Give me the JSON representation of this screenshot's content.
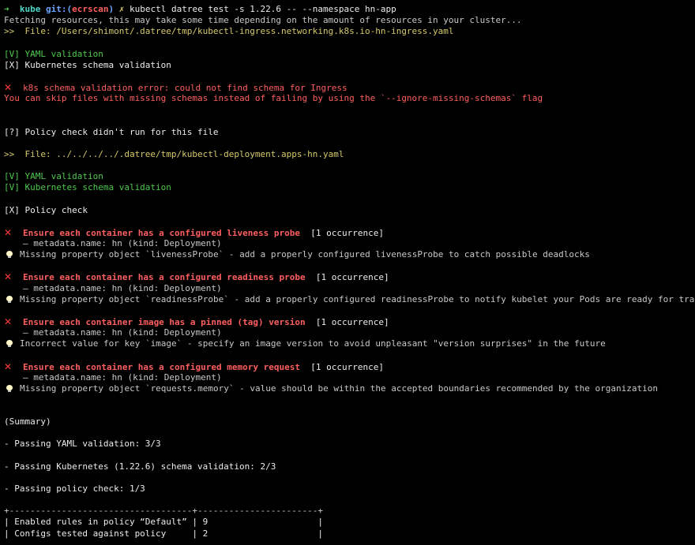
{
  "colors": {
    "background": "#000000",
    "error": "#ff5f5f",
    "success": "#4ec94e",
    "path": "#d6c96a"
  },
  "prompt": {
    "arrow": "➜",
    "dir": "kube",
    "git_label": "git:(",
    "branch": "ecrscan",
    "git_close": ")",
    "dirty_mark": "✗",
    "command": "kubectl datree test -s 1.22.6 -- --namespace hn-app"
  },
  "intro": "Fetching resources, this may take some time depending on the amount of resources in your cluster...",
  "file1": {
    "header": ">>  File: /Users/shimont/.datree/tmp/kubectl-ingress.networking.k8s.io-hn-ingress.yaml",
    "yaml_validation": "[V] YAML validation",
    "schema_validation": "[X] Kubernetes schema validation",
    "schema_error": "k8s schema validation error: could not find schema for Ingress",
    "skip_hint": "You can skip files with missing schemas instead of failing by using the `--ignore-missing-schemas` flag",
    "policy_check": "[?] Policy check didn't run for this file"
  },
  "file2": {
    "header": ">>  File: ../../../../.datree/tmp/kubectl-deployment.apps-hn.yaml",
    "yaml_validation": "[V] YAML validation",
    "schema_validation": "[V] Kubernetes schema validation",
    "policy_check": "[X] Policy check",
    "rules": [
      {
        "title": "Ensure each container has a configured liveness probe",
        "occurrence": "[1 occurrence]",
        "metadata": "— metadata.name: hn (kind: Deployment)",
        "hint": "Missing property object `livenessProbe` - add a properly configured livenessProbe to catch possible deadlocks"
      },
      {
        "title": "Ensure each container has a configured readiness probe",
        "occurrence": "[1 occurrence]",
        "metadata": "— metadata.name: hn (kind: Deployment)",
        "hint": "Missing property object `readinessProbe` - add a properly configured readinessProbe to notify kubelet your Pods are ready for traffic"
      },
      {
        "title": "Ensure each container image has a pinned (tag) version",
        "occurrence": "[1 occurrence]",
        "metadata": "— metadata.name: hn (kind: Deployment)",
        "hint": "Incorrect value for key `image` - specify an image version to avoid unpleasant \"version surprises\" in the future"
      },
      {
        "title": "Ensure each container has a configured memory request",
        "occurrence": "[1 occurrence]",
        "metadata": "— metadata.name: hn (kind: Deployment)",
        "hint": "Missing property object `requests.memory` - value should be within the accepted boundaries recommended by the organization"
      }
    ]
  },
  "summary": {
    "heading": "(Summary)",
    "yaml": "- Passing YAML validation: 3/3",
    "schema": "- Passing Kubernetes (1.22.6) schema validation: 2/3",
    "policy": "- Passing policy check: 1/3"
  },
  "table": {
    "border": "+-----------------------------------+-----------------------+",
    "rows": [
      "| Enabled rules in policy “Default” | 9                     |",
      "| Configs tested against policy     | 2                     |"
    ]
  }
}
